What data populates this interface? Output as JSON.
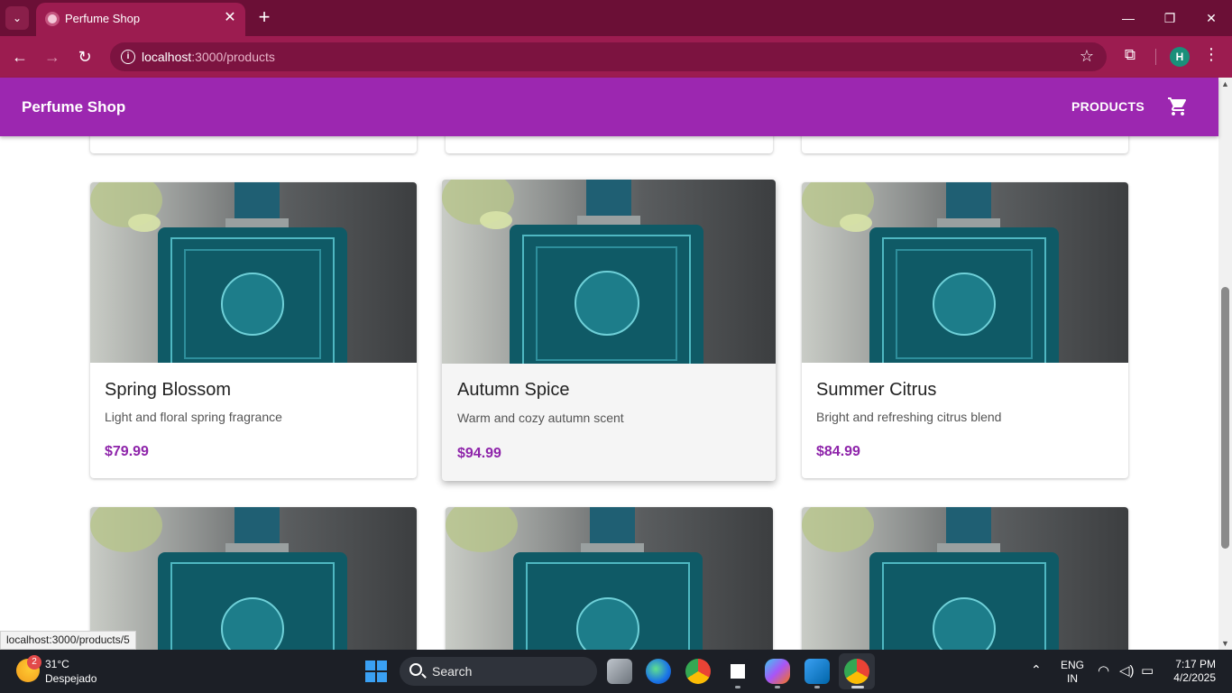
{
  "browser": {
    "tab_title": "Perfume Shop",
    "url_host": "localhost",
    "url_path": ":3000/products",
    "profile_initial": "H",
    "status_url": "localhost:3000/products/5"
  },
  "app": {
    "brand": "Perfume Shop",
    "nav_products": "PRODUCTS",
    "accent": "#9c27b0",
    "price_color": "#8e24aa"
  },
  "products": [
    {
      "name": "Spring Blossom",
      "description": "Light and floral spring fragrance",
      "price": "$79.99"
    },
    {
      "name": "Autumn Spice",
      "description": "Warm and cozy autumn scent",
      "price": "$94.99"
    },
    {
      "name": "Summer Citrus",
      "description": "Bright and refreshing citrus blend",
      "price": "$84.99"
    }
  ],
  "taskbar": {
    "weather_badge": "2",
    "temperature": "31°C",
    "condition": "Despejado",
    "search_label": "Search",
    "lang_line1": "ENG",
    "lang_line2": "IN",
    "time": "7:17 PM",
    "date": "4/2/2025"
  }
}
